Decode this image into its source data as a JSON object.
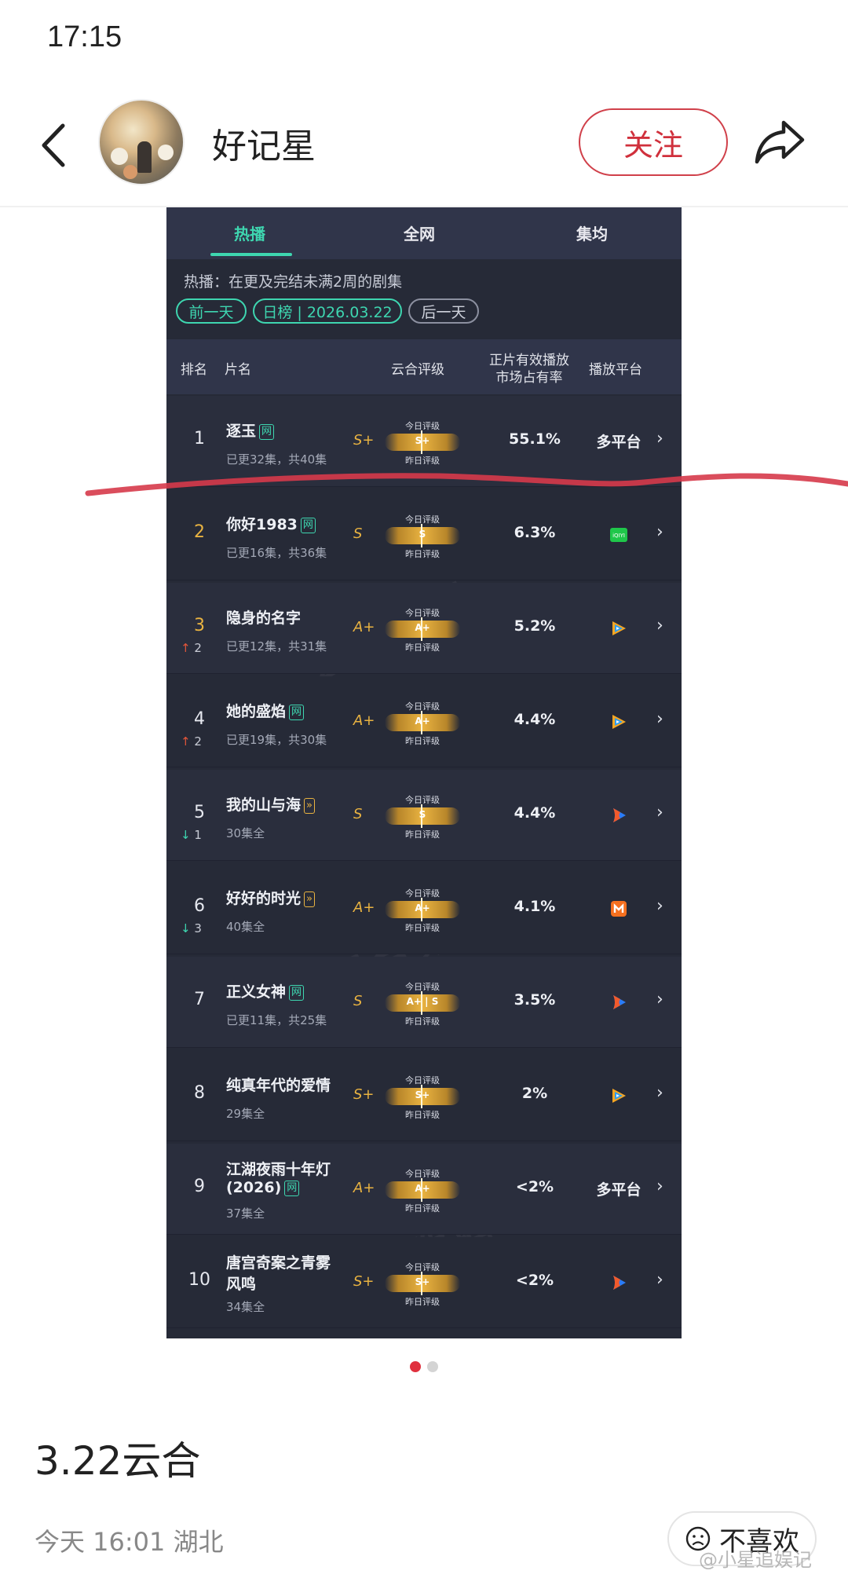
{
  "status_bar": {
    "time": "17:15"
  },
  "header": {
    "username": "好记星",
    "follow_label": "关注"
  },
  "panel": {
    "tabs": [
      {
        "label": "热播",
        "active": true
      },
      {
        "label": "全网",
        "active": false
      },
      {
        "label": "集均",
        "active": false
      }
    ],
    "note": "热播：在更及完结未满2周的剧集",
    "prev_day": "前一天",
    "current_list": "日榜 | 2026.03.22",
    "next_day": "后一天",
    "columns": {
      "rank": "排名",
      "title": "片名",
      "grade": "云合评级",
      "share_line1": "正片有效播放",
      "share_line2": "市场占有率",
      "platform": "播放平台"
    },
    "gauge_labels": {
      "today": "今日评级",
      "yesterday": "昨日评级"
    },
    "watermark": "云合数据",
    "rows": [
      {
        "rank": "1",
        "title": "逐玉",
        "badge": "网",
        "sub": "已更32集，共40集",
        "grade": "S+",
        "bar_grade": "S+",
        "share": "55.1%",
        "platform": "多平台",
        "platform_icon": ""
      },
      {
        "rank": "2",
        "title": "你好1983",
        "badge": "网",
        "sub": "已更16集，共36集",
        "grade": "S",
        "bar_grade": "S",
        "share": "6.3%",
        "platform": "",
        "platform_icon": "iqiyi-icon"
      },
      {
        "rank": "3",
        "change": "2",
        "dir": "up",
        "title": "隐身的名字",
        "badge": "",
        "sub": "已更12集，共31集",
        "grade": "A+",
        "bar_grade": "A+",
        "share": "5.2%",
        "platform": "",
        "platform_icon": "tencent-video-icon"
      },
      {
        "rank": "4",
        "change": "2",
        "dir": "up",
        "title": "她的盛焰",
        "badge": "网",
        "sub": "已更19集，共30集",
        "grade": "A+",
        "bar_grade": "A+",
        "share": "4.4%",
        "platform": "",
        "platform_icon": "tencent-video-icon"
      },
      {
        "rank": "5",
        "change": "1",
        "dir": "down",
        "title": "我的山与海",
        "badge": "»",
        "sub": "30集全",
        "grade": "S",
        "bar_grade": "S",
        "share": "4.4%",
        "platform": "",
        "platform_icon": "youku-icon"
      },
      {
        "rank": "6",
        "change": "3",
        "dir": "down",
        "title": "好好的时光",
        "badge": "»",
        "sub": "40集全",
        "grade": "A+",
        "bar_grade": "A+",
        "share": "4.1%",
        "platform": "",
        "platform_icon": "mango-tv-icon"
      },
      {
        "rank": "7",
        "title": "正义女神",
        "badge": "网",
        "sub": "已更11集，共25集",
        "grade": "S",
        "bar_grade": "A+ | S",
        "share": "3.5%",
        "platform": "",
        "platform_icon": "youku-icon"
      },
      {
        "rank": "8",
        "title": "纯真年代的爱情",
        "badge": "",
        "sub": "29集全",
        "grade": "S+",
        "bar_grade": "S+",
        "share": "2%",
        "platform": "",
        "platform_icon": "tencent-video-icon"
      },
      {
        "rank": "9",
        "title": "江湖夜雨十年灯",
        "title2": "(2026)",
        "badge": "网",
        "sub": "37集全",
        "grade": "A+",
        "bar_grade": "A+",
        "share": "<2%",
        "platform": "多平台",
        "platform_icon": ""
      },
      {
        "rank": "10",
        "title": "唐宫奇案之青雾",
        "title2": "风鸣",
        "badge": "",
        "sub": "34集全",
        "grade": "S+",
        "bar_grade": "S+",
        "share": "<2%",
        "platform": "",
        "platform_icon": "youku-icon"
      }
    ]
  },
  "post": {
    "title": "3.22云合",
    "meta": "今天 16:01 湖北",
    "dislike_label": "不喜欢",
    "footer_watermark": "@小星追娱记"
  },
  "colors": {
    "accent_red": "#e0303e",
    "panel_bg": "#262a37",
    "teal": "#3ed6b0",
    "gold": "#e9b341"
  }
}
